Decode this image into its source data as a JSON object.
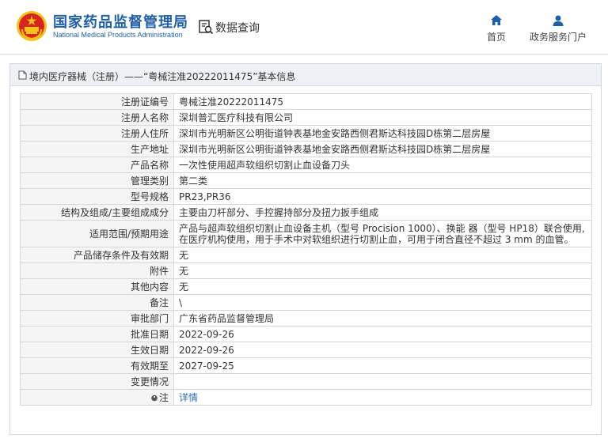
{
  "header": {
    "org_name_cn": "国家药品监督管理局",
    "org_name_en": "National Medical Products Administration",
    "query_label": "数据查询",
    "nav": [
      {
        "label": "首页",
        "icon": "home-icon"
      },
      {
        "label": "政务服务门户",
        "icon": "user-icon"
      }
    ]
  },
  "breadcrumb": "境内医疗器械（注册）——“粤械注准20222011475”基本信息",
  "rows": [
    {
      "key": "注册证编号",
      "value": "粤械注准20222011475"
    },
    {
      "key": "注册人名称",
      "value": "深圳普汇医疗科技有限公司"
    },
    {
      "key": "注册人住所",
      "value": "深圳市光明新区公明街道钟表基地金安路西侧君斯达科技园D栋第二层房屋"
    },
    {
      "key": "生产地址",
      "value": "深圳市光明新区公明街道钟表基地金安路西侧君斯达科技园D栋第二层房屋"
    },
    {
      "key": "产品名称",
      "value": "一次性使用超声软组织切割止血设备刀头"
    },
    {
      "key": "管理类别",
      "value": "第二类"
    },
    {
      "key": "型号规格",
      "value": "PR23,PR36"
    },
    {
      "key": "结构及组成/主要组成成分",
      "value": "主要由刀杆部分、手控握持部分及扭力扳手组成"
    },
    {
      "key": "适用范围/预期用途",
      "value": "产品与超声软组织切割止血设备主机（型号 Procision 1000）、换能 器（型号 HP18）联合使用,在医疗机构使用，用于手术中对软组织进行切割止血，可用于闭合直径不超过 3 mm 的血管。"
    },
    {
      "key": "产品储存条件及有效期",
      "value": "无"
    },
    {
      "key": "附件",
      "value": "无"
    },
    {
      "key": "其他内容",
      "value": "无"
    },
    {
      "key": "备注",
      "value": "\\"
    },
    {
      "key": "审批部门",
      "value": "广东省药品监督管理局"
    },
    {
      "key": "批准日期",
      "value": "2022-09-26"
    },
    {
      "key": "生效日期",
      "value": "2022-09-26"
    },
    {
      "key": "有效期至",
      "value": "2027-09-25"
    },
    {
      "key": "变更情况",
      "value": ""
    }
  ],
  "note_row": {
    "key": "注",
    "link": "详情",
    "icon": "info-icon"
  },
  "colors": {
    "brand_blue": "#1f5fa8",
    "link_blue": "#2f6fb3",
    "emblem_red": "#d7261f",
    "emblem_gold": "#f4c21a"
  }
}
